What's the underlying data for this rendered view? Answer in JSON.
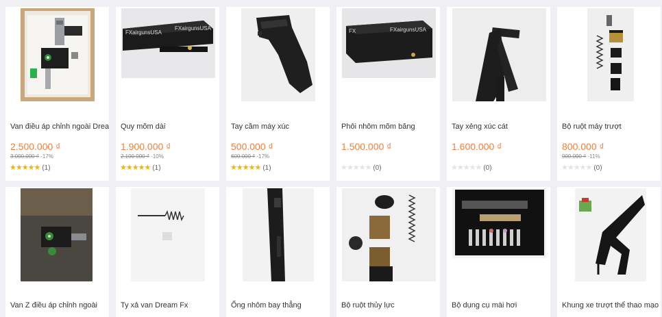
{
  "products_row1": [
    {
      "name": "Van điều áp chỉnh ngoài Dream",
      "price": "2.500.000 ₫",
      "old_price": "3.000.000 ₫",
      "discount": "-17%",
      "rating_filled": 5,
      "reviews": "(1)"
    },
    {
      "name": "Quy mõm dài",
      "price": "1.900.000 ₫",
      "old_price": "2.100.000 ₫",
      "discount": "-10%",
      "rating_filled": 5,
      "reviews": "(1)"
    },
    {
      "name": "Tay cầm máy xúc",
      "price": "500.000 ₫",
      "old_price": "600.000 ₫",
      "discount": "-17%",
      "rating_filled": 5,
      "reviews": "(1)"
    },
    {
      "name": "Phôi nhôm mõm băng",
      "price": "1.500.000 ₫",
      "old_price": "",
      "discount": "",
      "rating_filled": 0,
      "reviews": "(0)"
    },
    {
      "name": "Tay xẻng xúc cát",
      "price": "1.600.000 ₫",
      "old_price": "",
      "discount": "",
      "rating_filled": 0,
      "reviews": "(0)"
    },
    {
      "name": "Bộ ruột máy trượt",
      "price": "800.000 ₫",
      "old_price": "900.000 ₫",
      "discount": "-11%",
      "rating_filled": 0,
      "reviews": "(0)"
    }
  ],
  "products_row2": [
    {
      "name": "Van Z điều áp chỉnh ngoài"
    },
    {
      "name": "Ty xả van Dream Fx"
    },
    {
      "name": "Ống nhôm bay thẳng"
    },
    {
      "name": "Bộ ruột thủy lực"
    },
    {
      "name": "Bộ dụng cụ mài hơi"
    },
    {
      "name": "Khung xe trượt thể thao mạo"
    }
  ],
  "image_labels": {
    "fx_brand": "FXairgunsUSA",
    "fx_brand2": "FXairgunsUSA"
  },
  "colors": {
    "price": "#ee7f3a",
    "star_on": "#f5b301",
    "star_off": "#e3e3e3",
    "background": "#f0f0f4"
  }
}
